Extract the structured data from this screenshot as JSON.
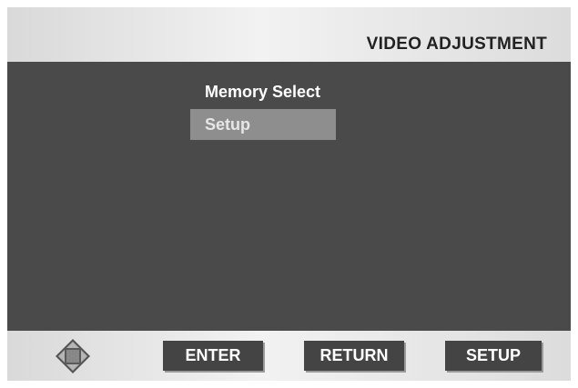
{
  "header": {
    "title": "VIDEO ADJUSTMENT"
  },
  "menu": {
    "items": [
      {
        "label": "Memory Select",
        "selected": false
      },
      {
        "label": "Setup",
        "selected": true
      }
    ]
  },
  "footer": {
    "nav_icon": "dpad-icon",
    "buttons": {
      "enter": "ENTER",
      "return": "RETURN",
      "setup": "SETUP"
    }
  },
  "colors": {
    "panel": "#4a4a4a",
    "highlight": "#8e8e8e",
    "button": "#444444"
  }
}
